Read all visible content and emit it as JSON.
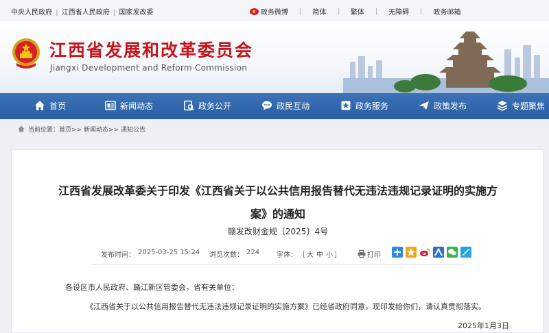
{
  "topbar": {
    "links": [
      "中央人民政府",
      "江西省人民政府",
      "国家发改委"
    ],
    "separator": "|",
    "weibo": "政务微博",
    "simplified": "简体",
    "traditional": "繁体",
    "accessibility": "无障碍",
    "email": "政务邮箱"
  },
  "header": {
    "title": "江西省发展和改革委员会",
    "subtitle": "Jiangxi Development and Reform Commission"
  },
  "nav": {
    "items": [
      {
        "label": "首页",
        "icon": "home-icon"
      },
      {
        "label": "新闻动态",
        "icon": "news-icon"
      },
      {
        "label": "政务公开",
        "icon": "open-gov-icon"
      },
      {
        "label": "政民互动",
        "icon": "chat-icon"
      },
      {
        "label": "政务服务",
        "icon": "service-icon"
      },
      {
        "label": "政策发布",
        "icon": "send-icon"
      },
      {
        "label": "专题聚焦",
        "icon": "topic-icon"
      }
    ]
  },
  "breadcrumb": {
    "prefix": "当前位置：",
    "items": [
      "首页",
      "新闻动态",
      "通知公告"
    ],
    "separator": ">>"
  },
  "article": {
    "title_line1": "江西省发展改革委关于印发《江西省关于以公共信用报告替代无违法违规记录证明的实施方",
    "title_line2": "案》的通知",
    "doc_number": "赣发改财金规〔2025〕4号",
    "publish_label": "发布时间：",
    "publish_time": "2025-03-25 15:24",
    "views_label": "浏览次数：",
    "views": "224",
    "font_label": "字体：",
    "font_open": "［",
    "font_large": "大",
    "font_medium": "中",
    "font_small": "小",
    "font_close": "］",
    "print_label": "打印",
    "salutation": "各设区市人民政府、赣江新区管委会，省有关单位：",
    "body": "《江西省关于以公共信用报告替代无违法违规记录证明的实施方案》已经省政府同意，现印发给你们，请认真贯彻落实。",
    "date": "2025年1月3日"
  },
  "share": {
    "icons": [
      "share-plus-icon",
      "qzone-icon",
      "weibo-icon",
      "renren-icon",
      "wechat-icon",
      "douban-icon"
    ],
    "colors": [
      "#2f8ad8",
      "#f2a31b",
      "#e6162d",
      "#2b72c8",
      "#3fb04a",
      "#2aa4e0"
    ]
  }
}
